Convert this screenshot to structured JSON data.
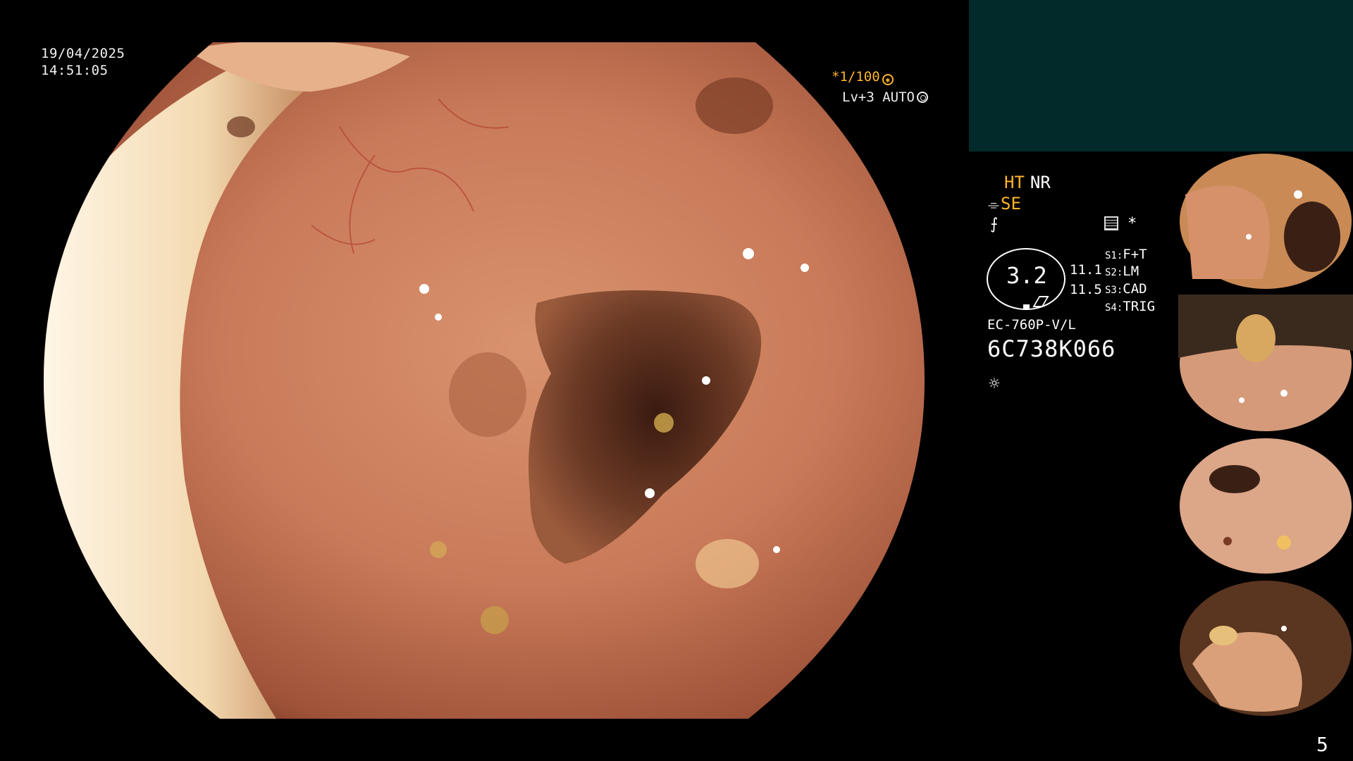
{
  "overlay": {
    "date": "19/04/2025",
    "time": "14:51:05",
    "shutter": "*1/100",
    "shutter_icon": "shutter-icon",
    "iris": "Lv+3 AUTO",
    "iris_icon": "iris-icon"
  },
  "panel": {
    "enhancement_ht": "HT",
    "enhancement_nr": "NR",
    "mode_se": "SE",
    "zoom_value": "3.2",
    "zoom_a": "11.1",
    "zoom_b": "11.5",
    "star": "*",
    "switches": [
      {
        "key": "S1:",
        "value": "F+T"
      },
      {
        "key": "S2:",
        "value": "LM"
      },
      {
        "key": "S3:",
        "value": "CAD"
      },
      {
        "key": "S4:",
        "value": "TRIG"
      }
    ],
    "scope_model": "EC-760P-V/L",
    "scope_serial": "6C738K066",
    "page_number": "5"
  },
  "colors": {
    "accent_orange": "#ffb52a",
    "patient_box": "#032a2a",
    "mucosa": "#c4785a"
  },
  "thumbnails": [
    {
      "name": "thumbnail-1"
    },
    {
      "name": "thumbnail-2"
    },
    {
      "name": "thumbnail-3"
    },
    {
      "name": "thumbnail-4"
    }
  ]
}
